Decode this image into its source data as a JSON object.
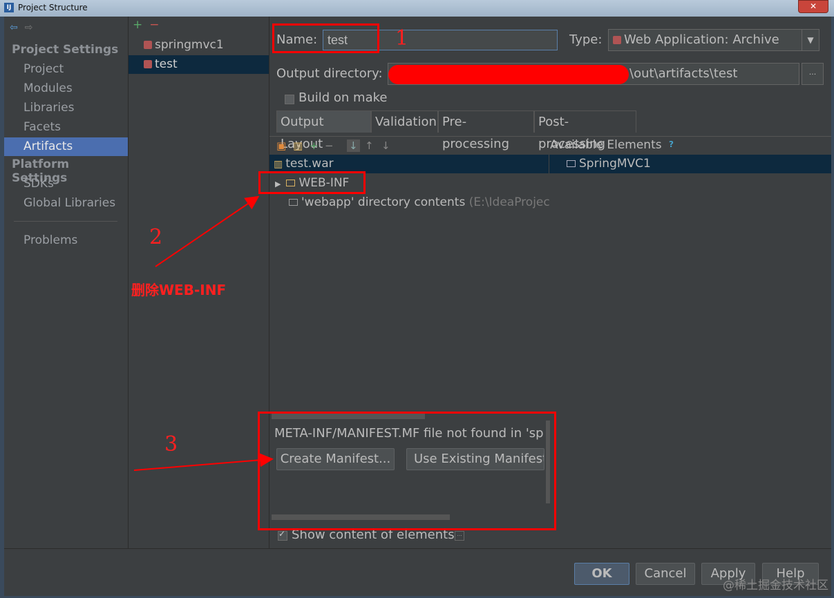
{
  "window": {
    "title": "Project Structure"
  },
  "nav": {
    "project_settings": "Project Settings",
    "items": [
      {
        "label": "Project"
      },
      {
        "label": "Modules"
      },
      {
        "label": "Libraries"
      },
      {
        "label": "Facets"
      },
      {
        "label": "Artifacts"
      }
    ],
    "platform_settings": "Platform Settings",
    "platform_items": [
      {
        "label": "SDKs"
      },
      {
        "label": "Global Libraries"
      }
    ],
    "problems": "Problems"
  },
  "artifacts": {
    "add": "+",
    "remove": "−",
    "items": [
      {
        "label": "springmvc1"
      },
      {
        "label": "test"
      }
    ]
  },
  "form": {
    "name_label": "Name:",
    "name_value": "test",
    "type_label": "Type:",
    "type_value": "Web Application: Archive",
    "output_label": "Output directory:",
    "output_value": "\\out\\artifacts\\test",
    "browse": "...",
    "build_on_make": "Build on make"
  },
  "tabs": [
    "Output Layout",
    "Validation",
    "Pre-processing",
    "Post-processing"
  ],
  "available_elements": {
    "label": "Available Elements",
    "help": "?",
    "item": "SpringMVC1"
  },
  "tree": {
    "root": "test.war",
    "web_inf": "WEB-INF",
    "webapp_label": "'webapp' directory contents",
    "webapp_path": "(E:\\IdeaProjec"
  },
  "manifest": {
    "message": "META-INF/MANIFEST.MF file not found in 'sp",
    "create_button": "Create Manifest...",
    "use_existing_button": "Use Existing Manifest"
  },
  "show_content": {
    "label": "Show content of elements",
    "extra": "..."
  },
  "footer": {
    "ok": "OK",
    "cancel": "Cancel",
    "apply": "Apply",
    "help": "Help"
  },
  "annotations": {
    "one": "1",
    "two": "2",
    "three": "3",
    "delete_text": "删除WEB-INF"
  },
  "watermark": "@稀土掘金技术社区",
  "colors": {
    "annotation_red": "#ff0000",
    "selection_blue": "#4b6eaf",
    "panel_bg": "#3c3f41"
  }
}
